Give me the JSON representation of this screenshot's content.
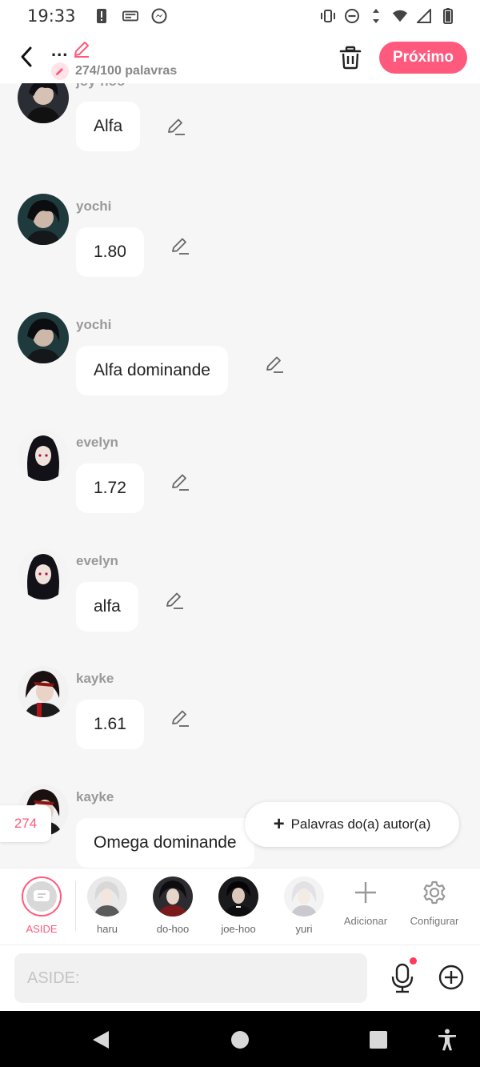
{
  "status_bar": {
    "time": "19:33",
    "left_icons": [
      "alert-icon",
      "card-icon",
      "messenger-icon"
    ],
    "right_icons": [
      "vibrate-icon",
      "do-not-disturb-icon",
      "data-arrows-icon",
      "wifi-icon",
      "signal-icon",
      "battery-icon"
    ]
  },
  "header": {
    "title": "...",
    "word_count": "274/100 palavras",
    "next_label": "Próximo"
  },
  "messages": [
    {
      "author": "joy-hoo",
      "text": "Alfa"
    },
    {
      "author": "yochi",
      "text": "1.80"
    },
    {
      "author": "yochi",
      "text": "Alfa dominande"
    },
    {
      "author": "evelyn",
      "text": "1.72"
    },
    {
      "author": "evelyn",
      "text": "alfa"
    },
    {
      "author": "kayke",
      "text": "1.61"
    },
    {
      "author": "kayke",
      "text": "Omega dominande"
    }
  ],
  "floating": {
    "count": "274",
    "author_words_label": "Palavras do(a) autor(a)"
  },
  "characters": [
    {
      "name": "ASIDE",
      "active": true
    },
    {
      "name": "haru"
    },
    {
      "name": "do-hoo"
    },
    {
      "name": "joe-hoo"
    },
    {
      "name": "yuri"
    }
  ],
  "tools": {
    "add_label": "Adicionar",
    "settings_label": "Configurar"
  },
  "input": {
    "placeholder": "ASIDE:"
  },
  "colors": {
    "accent": "#ff5a7d",
    "background": "#f6f6f6"
  }
}
